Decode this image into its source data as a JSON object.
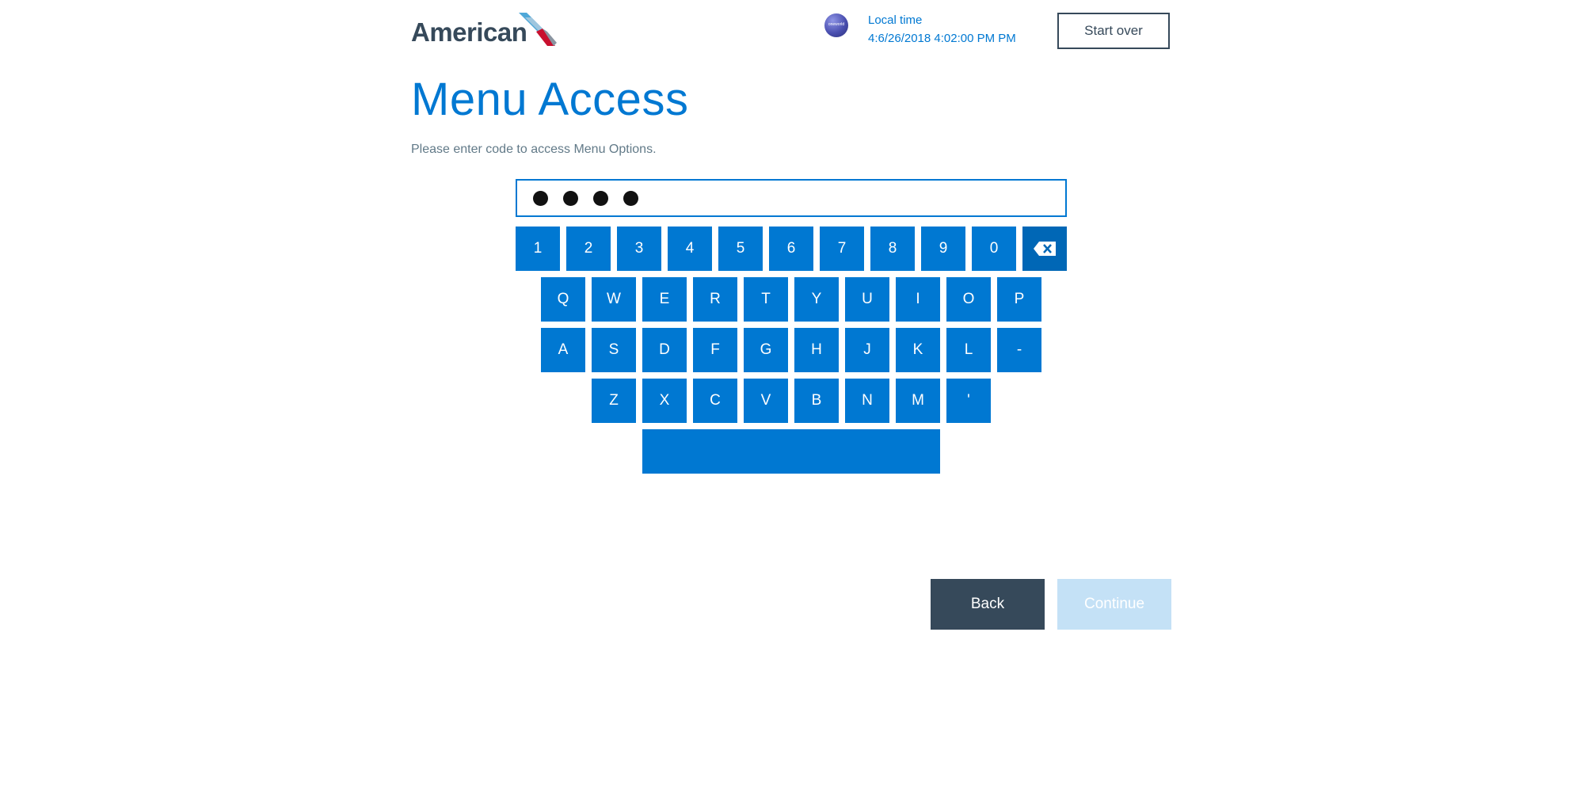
{
  "header": {
    "brand": "American",
    "oneworld_label": "oneworld",
    "local_time_label": "Local time",
    "local_time_value": "4:6/26/2018 4:02:00 PM PM",
    "start_over": "Start over"
  },
  "page": {
    "title": "Menu Access",
    "subtitle": "Please enter code to access Menu Options."
  },
  "code_input": {
    "masked_char_count": 4
  },
  "keyboard": {
    "row1": [
      "1",
      "2",
      "3",
      "4",
      "5",
      "6",
      "7",
      "8",
      "9",
      "0"
    ],
    "row2": [
      "Q",
      "W",
      "E",
      "R",
      "T",
      "Y",
      "U",
      "I",
      "O",
      "P"
    ],
    "row3": [
      "A",
      "S",
      "D",
      "F",
      "G",
      "H",
      "J",
      "K",
      "L",
      "-"
    ],
    "row4": [
      "Z",
      "X",
      "C",
      "V",
      "B",
      "N",
      "M",
      "'"
    ],
    "backspace_icon": "backspace-icon",
    "space_label": ""
  },
  "footer": {
    "back": "Back",
    "continue": "Continue"
  },
  "colors": {
    "brand_blue": "#0078d2",
    "dark_slate": "#36495a",
    "disabled_blue": "#c4e1f6"
  }
}
